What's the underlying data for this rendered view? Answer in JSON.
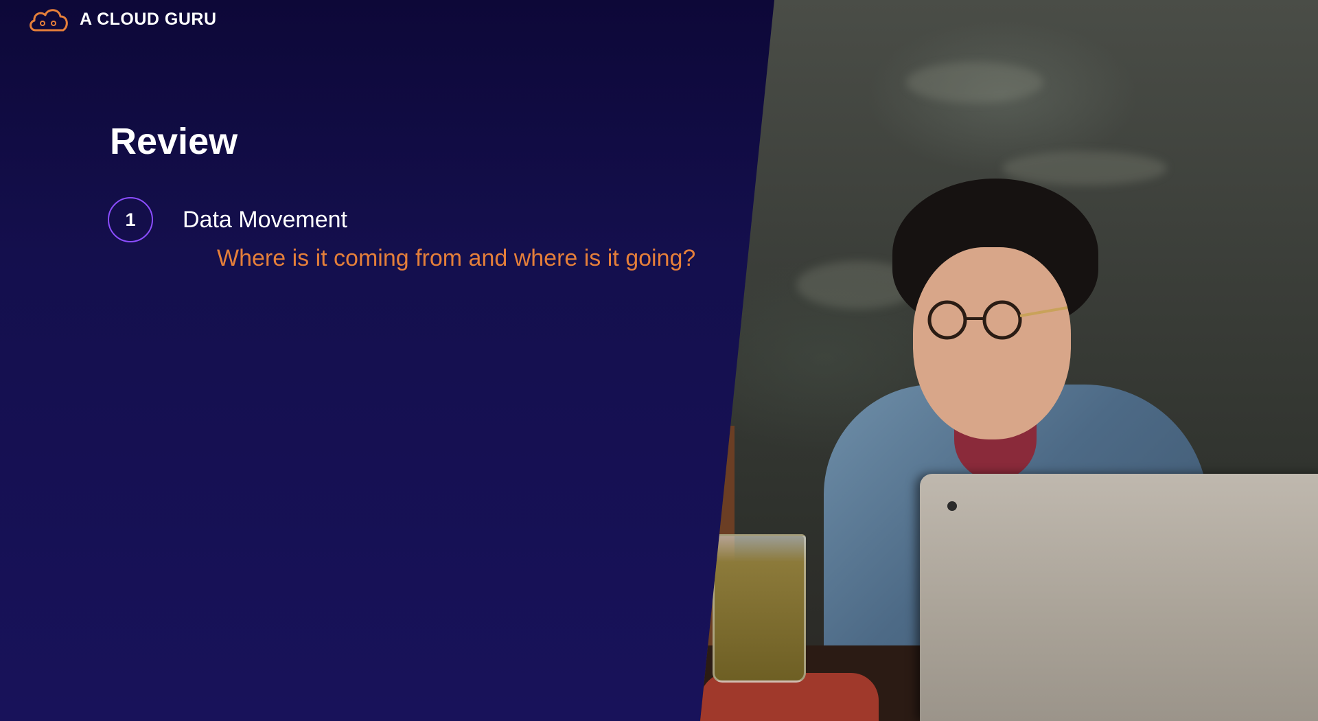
{
  "brand": {
    "name": "A CLOUD GURU",
    "icon": "cloud-logo-icon",
    "accent": "#e57f3a"
  },
  "slide": {
    "title": "Review",
    "items": [
      {
        "number": "1",
        "label": "Data Movement",
        "subtitle": "Where is it coming from and where is it going?"
      }
    ],
    "circle_color": "#8b4dff",
    "background_color": "#140f4d",
    "photo": "photo-person-laptop"
  }
}
